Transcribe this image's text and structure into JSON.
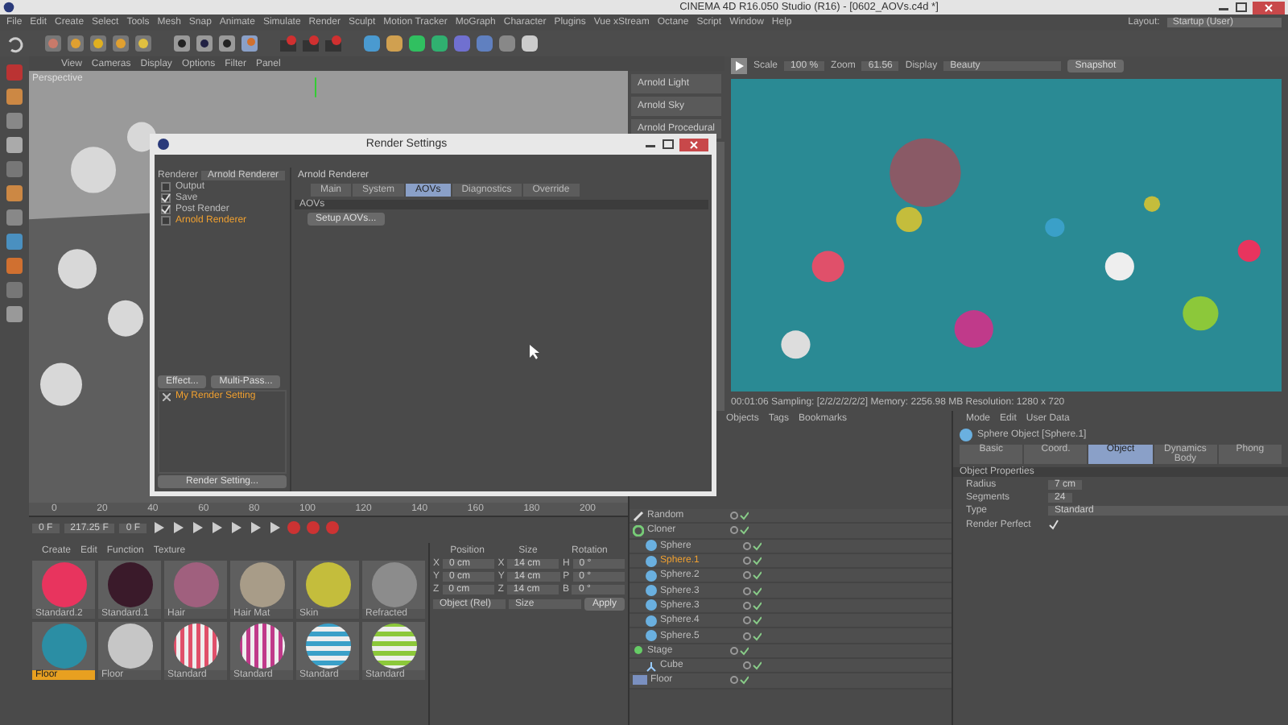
{
  "window": {
    "title": "CINEMA 4D R16.050 Studio (R16) - [0602_AOVs.c4d *]"
  },
  "menu": [
    "File",
    "Edit",
    "Create",
    "Select",
    "Tools",
    "Mesh",
    "Snap",
    "Animate",
    "Simulate",
    "Render",
    "Sculpt",
    "Motion Tracker",
    "MoGraph",
    "Character",
    "Plugins",
    "Vue xStream",
    "Octane",
    "Script",
    "Window",
    "Help"
  ],
  "layout": {
    "label": "Layout:",
    "value": "Startup (User)"
  },
  "viewport": {
    "menu": [
      "View",
      "Cameras",
      "Display",
      "Options",
      "Filter",
      "Panel"
    ],
    "camera": "Perspective"
  },
  "arnold_buttons": [
    "Arnold Light",
    "Arnold Sky",
    "Arnold Procedural"
  ],
  "render_view": {
    "scale_label": "Scale",
    "scale": "100 %",
    "zoom_label": "Zoom",
    "zoom": "61.56",
    "display_label": "Display",
    "display": "Beauty",
    "snapshot": "Snapshot",
    "status": "00:01:06 Sampling: [2/2/2/2/2/2] Memory: 2256.98 MB Resolution: 1280 x 720"
  },
  "render_settings": {
    "title": "Render Settings",
    "renderer_label": "Renderer",
    "renderer": "Arnold Renderer",
    "items": [
      {
        "label": "Output",
        "checked": false,
        "selected": false
      },
      {
        "label": "Save",
        "checked": true,
        "selected": false
      },
      {
        "label": "Post Render",
        "checked": true,
        "selected": false
      },
      {
        "label": "Arnold Renderer",
        "checked": false,
        "selected": true
      }
    ],
    "header": "Arnold Renderer",
    "tabs": [
      {
        "label": "Main",
        "selected": false
      },
      {
        "label": "System",
        "selected": false
      },
      {
        "label": "AOVs",
        "selected": true
      },
      {
        "label": "Diagnostics",
        "selected": false
      },
      {
        "label": "Override",
        "selected": false
      }
    ],
    "section": "AOVs",
    "setup_button": "Setup AOVs...",
    "effect_button": "Effect...",
    "multipass_button": "Multi-Pass...",
    "settings": [
      {
        "label": "My Render Setting",
        "selected": true
      }
    ],
    "render_setting_button": "Render Setting..."
  },
  "timeline": {
    "ticks": [
      "0",
      "20",
      "40",
      "60",
      "80",
      "100",
      "120",
      "140",
      "160",
      "180",
      "200"
    ],
    "start": "0 F",
    "end": "217.25 F",
    "current": "0 F"
  },
  "materials": {
    "menu": [
      "Create",
      "Edit",
      "Function",
      "Texture"
    ],
    "items": [
      {
        "name": "Standard.2",
        "color": "#e8345e",
        "kind": "solid",
        "selected": false
      },
      {
        "name": "Standard.1",
        "color": "#3a1a2a",
        "kind": "solid",
        "selected": false
      },
      {
        "name": "Hair",
        "color": "#a0607e",
        "kind": "solid",
        "selected": false
      },
      {
        "name": "Hair Mat",
        "color": "#a89c88",
        "kind": "fiber",
        "selected": false
      },
      {
        "name": "Skin",
        "color": "#c4bd3c",
        "kind": "solid",
        "selected": false
      },
      {
        "name": "Refracted",
        "color": "#8c8c8c",
        "kind": "solid",
        "selected": false
      },
      {
        "name": "Floor",
        "color": "#2b8ea4",
        "kind": "solid",
        "selected": true
      },
      {
        "name": "Floor",
        "color": "#c6c6c6",
        "kind": "solid",
        "selected": false
      },
      {
        "name": "Standard",
        "color": "#e0506a",
        "kind": "striped",
        "selected": false
      },
      {
        "name": "Standard",
        "color": "#c03a8a",
        "kind": "striped",
        "selected": false
      },
      {
        "name": "Standard",
        "color": "#3aa0c8",
        "kind": "banded",
        "selected": false
      },
      {
        "name": "Standard",
        "color": "#8cc83a",
        "kind": "banded",
        "selected": false
      }
    ]
  },
  "coordinates": {
    "headers": [
      "Position",
      "Size",
      "Rotation"
    ],
    "rows": [
      {
        "axis": "X",
        "position": "0 cm",
        "size_axis": "X",
        "size": "14 cm",
        "rot_axis": "H",
        "rotation": "0 °"
      },
      {
        "axis": "Y",
        "position": "0 cm",
        "size_axis": "Y",
        "size": "14 cm",
        "rot_axis": "P",
        "rotation": "0 °"
      },
      {
        "axis": "Z",
        "position": "0 cm",
        "size_axis": "Z",
        "size": "14 cm",
        "rot_axis": "B",
        "rotation": "0 °"
      }
    ],
    "mode": "Object (Rel)",
    "size_mode": "Size",
    "apply": "Apply"
  },
  "objects": {
    "menu": [
      "Objects",
      "Tags",
      "Bookmarks"
    ],
    "items": [
      {
        "name": "Random",
        "selected": false,
        "kind": "effector"
      },
      {
        "name": "Cloner",
        "selected": false,
        "kind": "cloner",
        "children": [
          {
            "name": "Sphere",
            "selected": false,
            "kind": "sphere"
          },
          {
            "name": "Sphere.1",
            "selected": true,
            "kind": "sphere"
          },
          {
            "name": "Sphere.2",
            "selected": false,
            "kind": "sphere"
          },
          {
            "name": "Sphere.3",
            "selected": false,
            "kind": "sphere"
          },
          {
            "name": "Sphere.3",
            "selected": false,
            "kind": "sphere"
          },
          {
            "name": "Sphere.4",
            "selected": false,
            "kind": "sphere"
          },
          {
            "name": "Sphere.5",
            "selected": false,
            "kind": "sphere"
          }
        ]
      },
      {
        "name": "Stage",
        "selected": false,
        "kind": "stage",
        "children": [
          {
            "name": "Cube",
            "selected": false,
            "kind": "cube"
          }
        ]
      },
      {
        "name": "Floor",
        "selected": false,
        "kind": "floor"
      }
    ]
  },
  "attributes": {
    "menu": [
      "Mode",
      "Edit",
      "User Data"
    ],
    "title": "Sphere Object [Sphere.1]",
    "tabs": [
      {
        "label": "Basic",
        "selected": false
      },
      {
        "label": "Coord.",
        "selected": false
      },
      {
        "label": "Object",
        "selected": true
      },
      {
        "label": "Dynamics Body",
        "selected": false
      },
      {
        "label": "Phong",
        "selected": false
      }
    ],
    "section": "Object Properties",
    "fields": [
      {
        "label": "Radius",
        "kind": "number",
        "value": "7 cm"
      },
      {
        "label": "Segments",
        "kind": "number",
        "value": "24"
      },
      {
        "label": "Type",
        "kind": "dropdown",
        "value": "Standard"
      },
      {
        "label": "Render Perfect",
        "kind": "checkbox",
        "checked": true
      }
    ]
  }
}
